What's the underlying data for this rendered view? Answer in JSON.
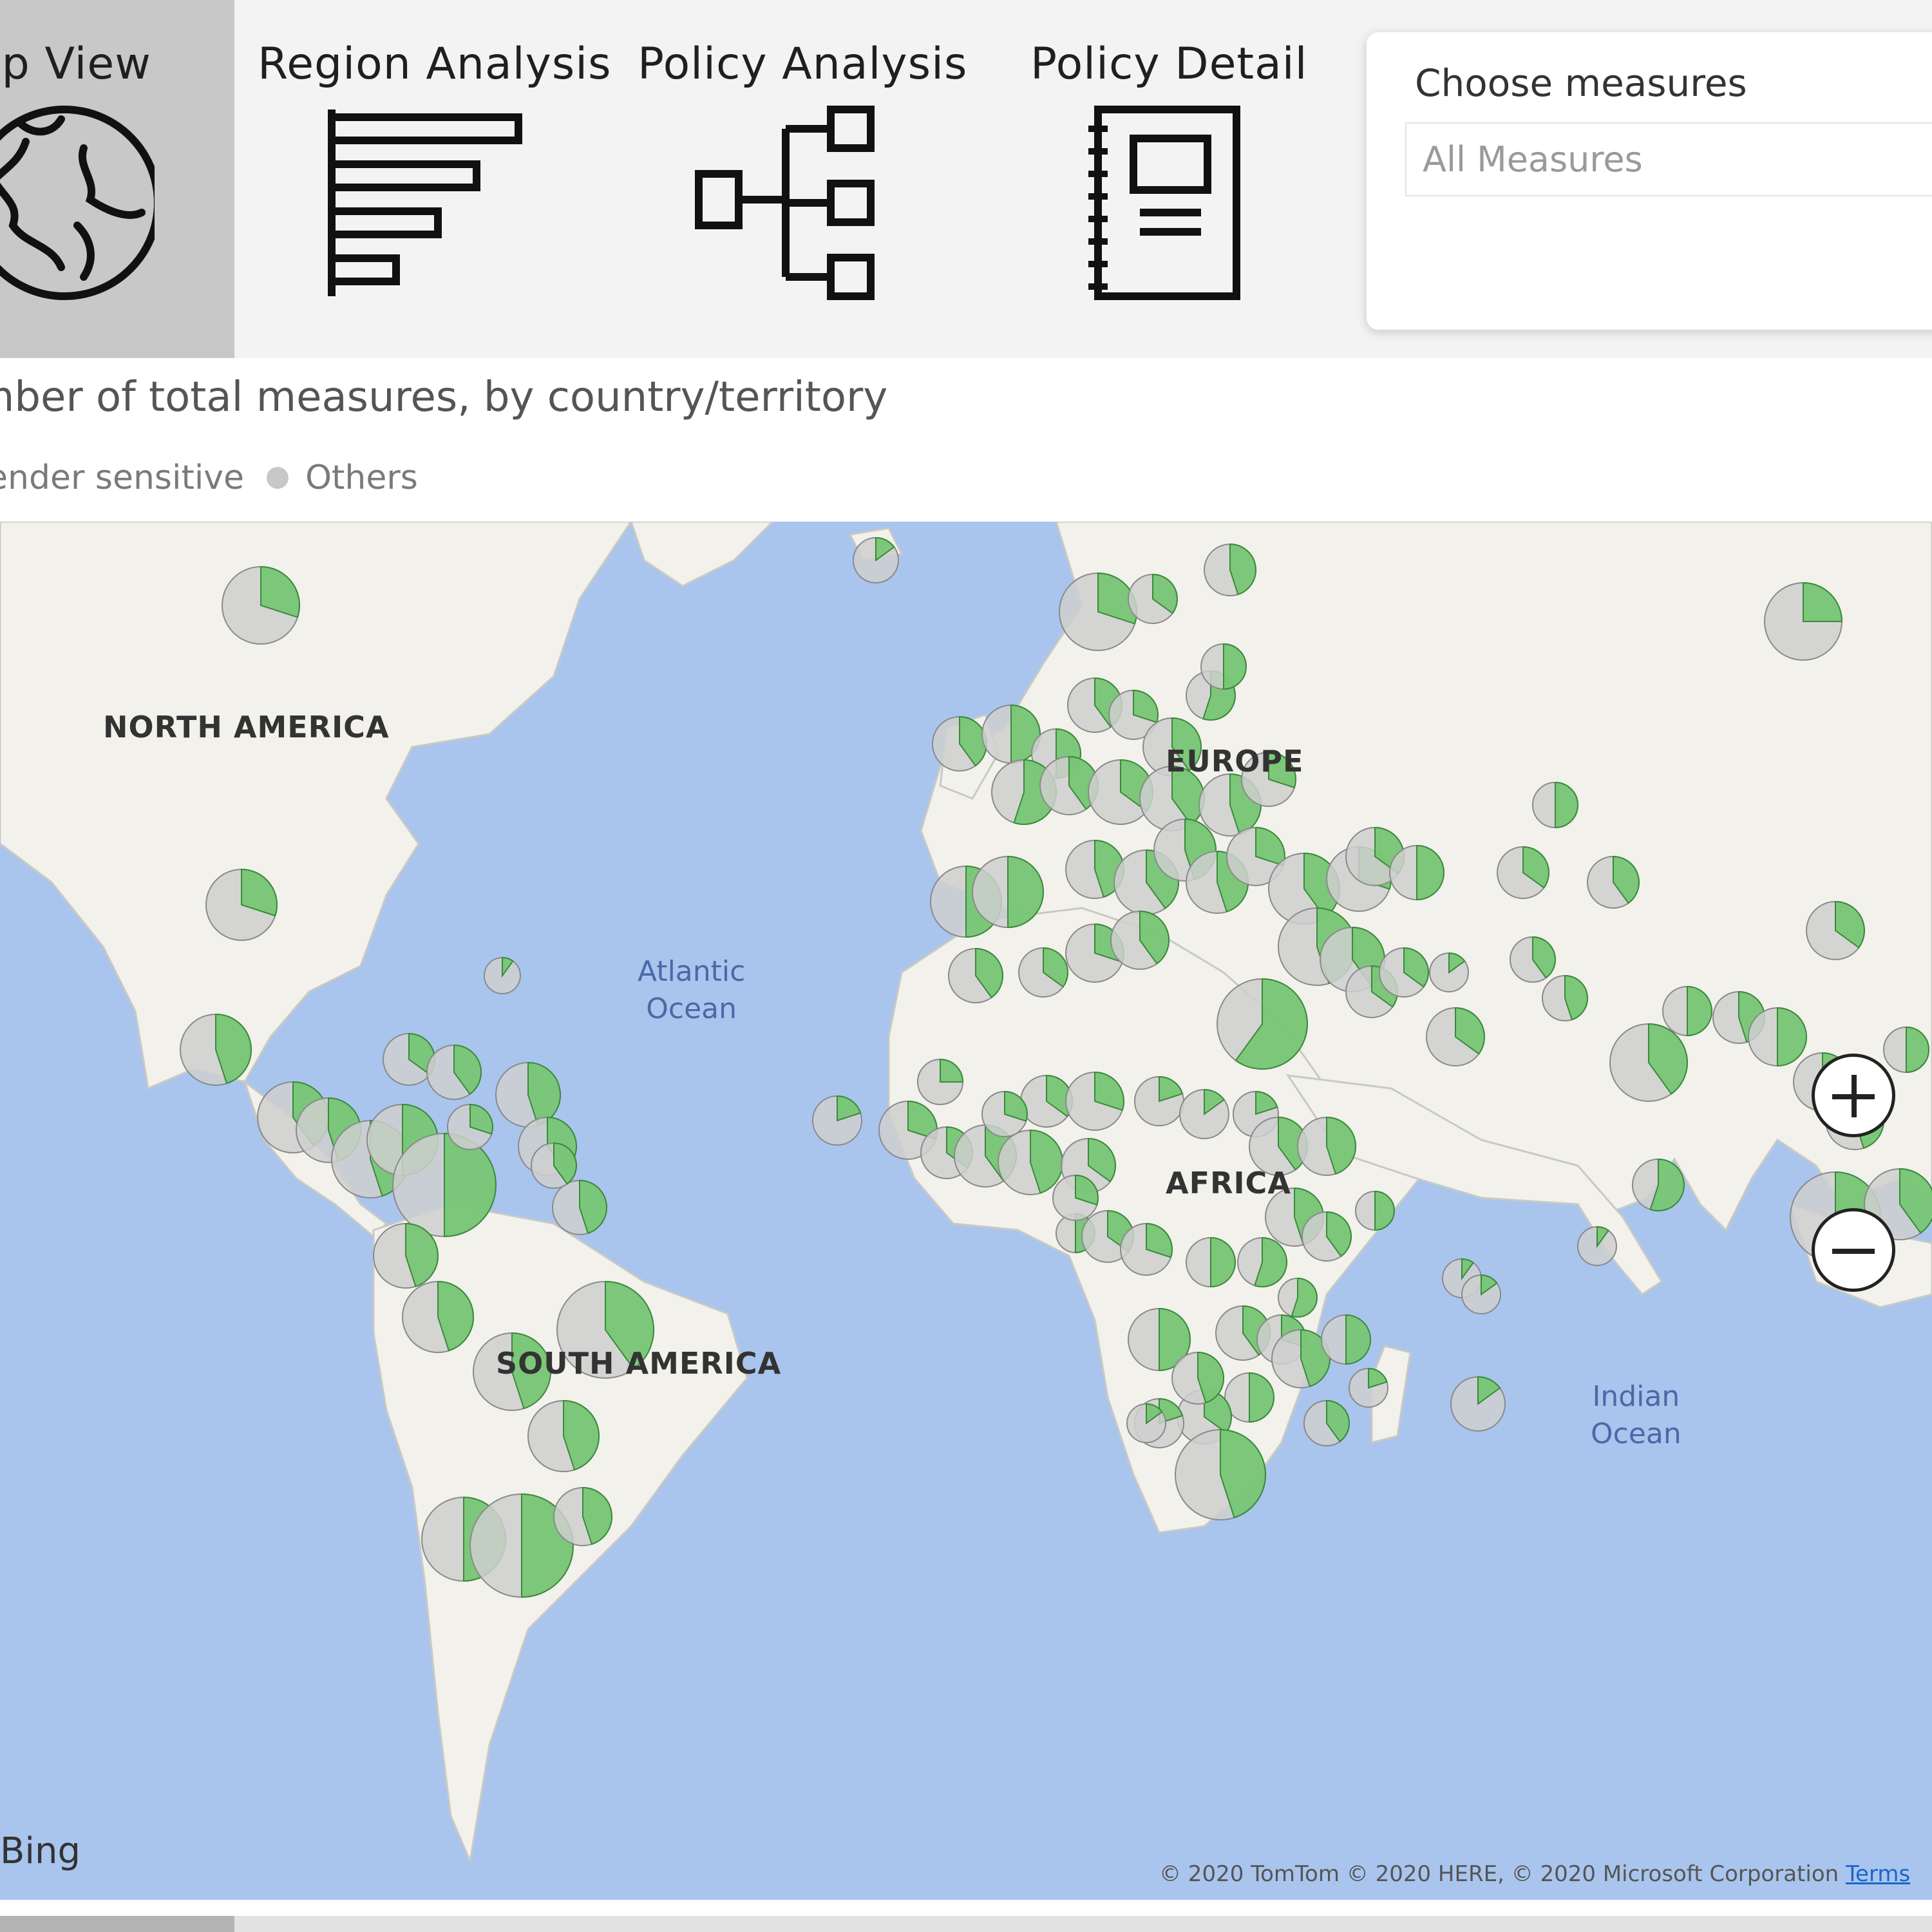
{
  "nav": {
    "items": [
      {
        "label": "ap View",
        "icon": "globe-icon",
        "active": true
      },
      {
        "label": "Region Analysis",
        "icon": "bar-chart-icon",
        "active": false
      },
      {
        "label": "Policy Analysis",
        "icon": "hierarchy-icon",
        "active": false
      },
      {
        "label": "Policy Detail",
        "icon": "notebook-icon",
        "active": false
      }
    ]
  },
  "filter": {
    "title": "Choose measures",
    "value": "All Measures"
  },
  "chart": {
    "title": "mber of total measures, by country/territory",
    "legend": [
      {
        "label": "ender sensitive",
        "color": "#6cc46a"
      },
      {
        "label": "Others",
        "color": "#c8c8c8"
      }
    ]
  },
  "map": {
    "continents": [
      "NORTH AMERICA",
      "EUROPE",
      "AFRICA",
      "SOUTH AMERICA"
    ],
    "oceans": [
      {
        "line1": "Atlantic",
        "line2": "Ocean"
      },
      {
        "line1": "Indian",
        "line2": "Ocean"
      }
    ],
    "attribution": "Bing",
    "copyright": "© 2020 TomTom © 2020 HERE, © 2020 Microsoft Corporation",
    "terms": "Terms",
    "colors": {
      "ocean": "#a9c5ee",
      "land": "#f2f1ec",
      "gender": "#6cc46a",
      "others": "#cfcfcf"
    }
  }
}
